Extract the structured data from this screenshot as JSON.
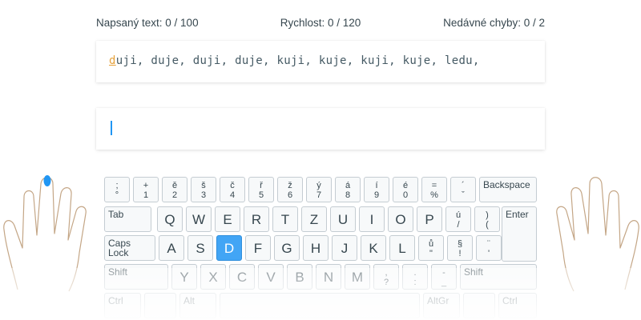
{
  "stats": {
    "typed": "Napsaný text: 0 / 100",
    "speed": "Rychlost: 0 / 120",
    "errors": "Nedávné chyby: 0 / 2"
  },
  "lesson": {
    "current_char": "d",
    "remaining_text": "uji, duje, duji, duje, kuji, kuje, kuji, kuje, ledu,"
  },
  "input": {
    "value": ""
  },
  "accent_color": "#42a5f5",
  "highlight_key": "D",
  "keyboard": {
    "row1": [
      {
        "top": ";",
        "bot": "°"
      },
      {
        "top": "+",
        "bot": "1"
      },
      {
        "top": "ě",
        "bot": "2"
      },
      {
        "top": "š",
        "bot": "3"
      },
      {
        "top": "č",
        "bot": "4"
      },
      {
        "top": "ř",
        "bot": "5"
      },
      {
        "top": "ž",
        "bot": "6"
      },
      {
        "top": "ý",
        "bot": "7"
      },
      {
        "top": "á",
        "bot": "8"
      },
      {
        "top": "í",
        "bot": "9"
      },
      {
        "top": "é",
        "bot": "0"
      },
      {
        "top": "=",
        "bot": "%"
      },
      {
        "top": "´",
        "bot": "ˇ"
      }
    ],
    "backspace": "Backspace",
    "tab": "Tab",
    "row2": [
      "Q",
      "W",
      "E",
      "R",
      "T",
      "Z",
      "U",
      "I",
      "O",
      "P"
    ],
    "row2_extra": [
      {
        "top": "ú",
        "bot": "/"
      },
      {
        "top": ")",
        "bot": "("
      }
    ],
    "enter": "Enter",
    "caps": "Caps Lock",
    "row3": [
      "A",
      "S",
      "D",
      "F",
      "G",
      "H",
      "J",
      "K",
      "L"
    ],
    "row3_extra": [
      {
        "top": "ů",
        "bot": "\""
      },
      {
        "top": "§",
        "bot": "!"
      },
      {
        "top": "¨",
        "bot": "'"
      }
    ],
    "shift_left": "Shift",
    "row4": [
      "Y",
      "X",
      "C",
      "V",
      "B",
      "N",
      "M"
    ],
    "row4_extra": [
      {
        "top": ",",
        "bot": "?"
      },
      {
        "top": ".",
        "bot": ":"
      },
      {
        "top": "-",
        "bot": "_"
      }
    ],
    "shift_right": "Shift",
    "ctrl_left": "Ctrl",
    "alt_left": "Alt",
    "altgr": "AltGr",
    "ctrl_right": "Ctrl"
  }
}
